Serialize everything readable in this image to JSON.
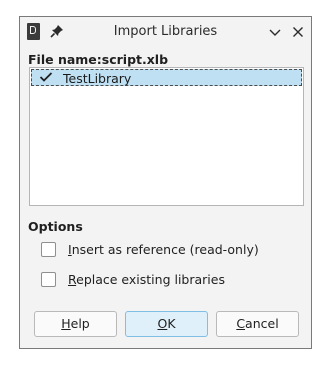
{
  "window": {
    "title": "Import Libraries"
  },
  "file": {
    "label": "File name:script.xlb"
  },
  "library_list": {
    "items": [
      {
        "label": "TestLibrary",
        "checked": true
      }
    ]
  },
  "options": {
    "heading": "Options",
    "insert_reference": {
      "mnemonic": "I",
      "rest": "nsert as reference (read-only)",
      "checked": false
    },
    "replace_existing": {
      "mnemonic": "R",
      "rest": "eplace existing libraries",
      "checked": false
    }
  },
  "buttons": {
    "help": {
      "mnemonic": "H",
      "rest": "elp"
    },
    "ok": {
      "mnemonic": "O",
      "rest": "K"
    },
    "cancel": {
      "mnemonic": "C",
      "rest": "ancel"
    }
  },
  "colors": {
    "selection": "#bfe0f3",
    "default_button": "#dff0fa",
    "dialog_bg": "#f3f3f3"
  }
}
